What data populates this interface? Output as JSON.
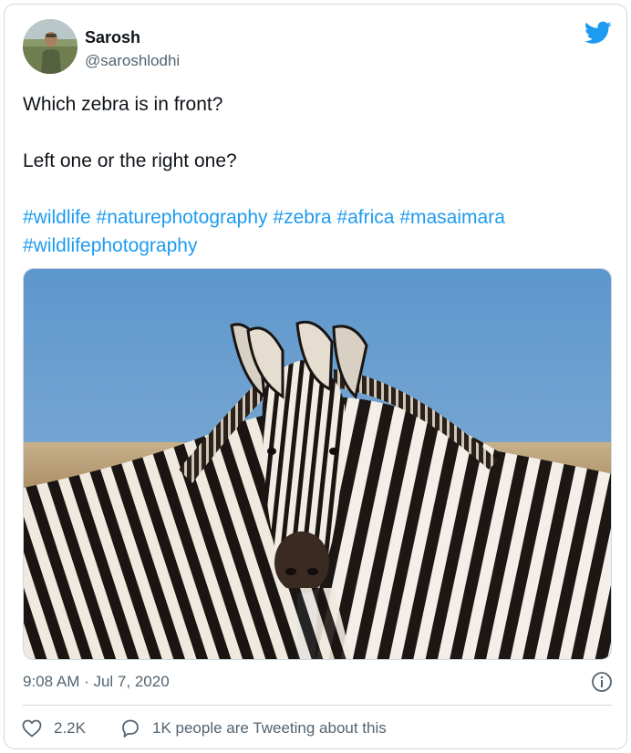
{
  "author": {
    "display_name": "Sarosh",
    "handle": "@saroshlodhi"
  },
  "tweet": {
    "line1": "Which zebra is in front?",
    "line2": "Left one or the right one?",
    "hashtags_row1": [
      "#wildlife",
      "#naturephotography",
      "#zebra",
      "#africa",
      "#masaimara"
    ],
    "hashtags_row2": [
      "#wildlifephotography"
    ]
  },
  "meta": {
    "timestamp": "9:08 AM · Jul 7, 2020"
  },
  "actions": {
    "like_count": "2.2K",
    "conversation_label": "1K people are Tweeting about this"
  },
  "colors": {
    "link": "#1d9bf0",
    "secondary_text": "#536471",
    "border": "#cfd9de"
  },
  "icons": [
    "twitter-bird-icon",
    "info-icon",
    "heart-icon",
    "speech-bubble-icon"
  ]
}
